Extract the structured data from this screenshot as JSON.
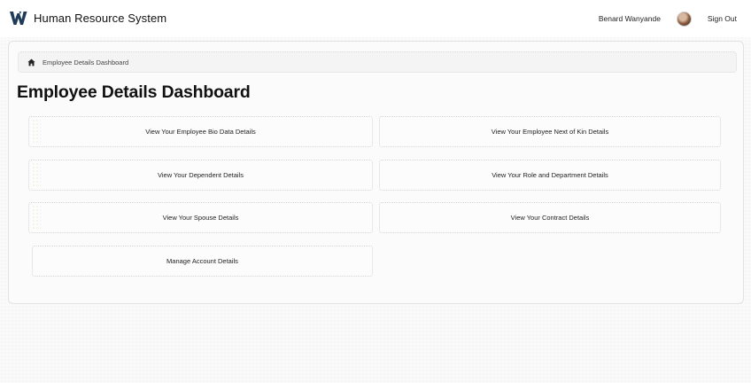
{
  "app": {
    "title": "Human Resource System",
    "user_name": "Benard Wanyande",
    "signout_label": "Sign Out"
  },
  "breadcrumb": {
    "icon": "home-icon",
    "current": "Employee Details Dashboard"
  },
  "page": {
    "title": "Employee Details Dashboard"
  },
  "actions": {
    "bio_data": "View Your Employee Bio Data Details",
    "next_of_kin": "View Your Employee Next of Kin Details",
    "dependent": "View Your Dependent Details",
    "role_department": "View Your Role and Department Details",
    "spouse": "View Your Spouse Details",
    "contract": "View Your Contract Details",
    "manage_account": "Manage Account Details"
  },
  "colors": {
    "logo": "#1f3b57",
    "text": "#1f1f1f",
    "background": "#fafafa"
  }
}
